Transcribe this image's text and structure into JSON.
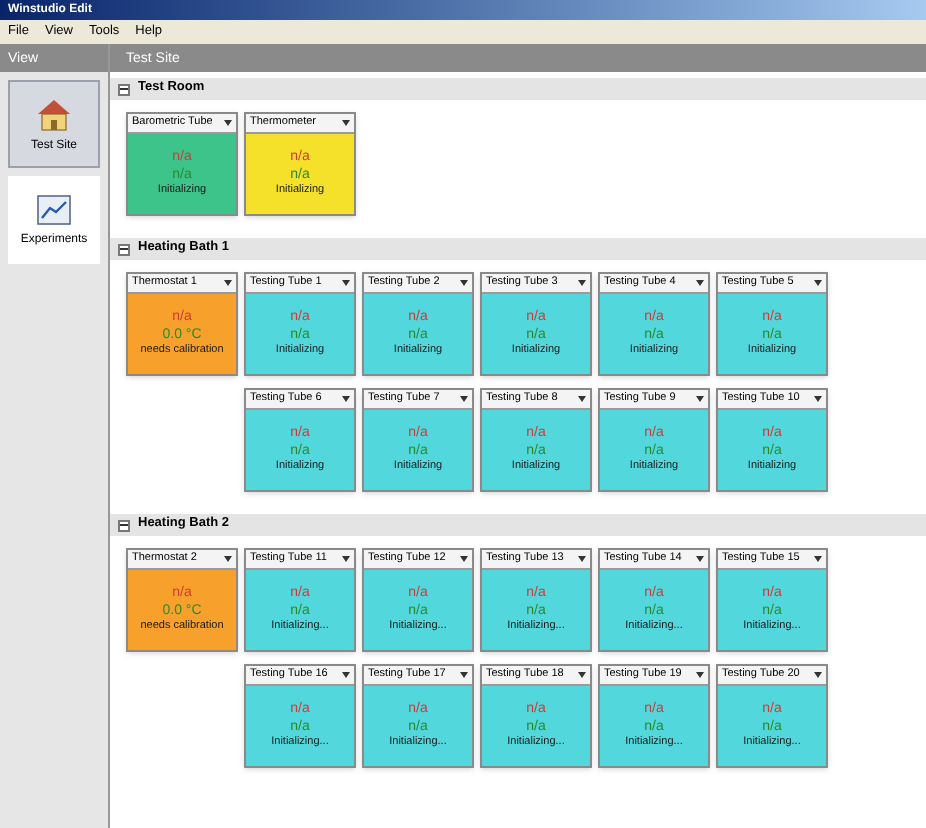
{
  "window": {
    "title": "Winstudio Edit"
  },
  "menu": [
    "File",
    "View",
    "Tools",
    "Help"
  ],
  "sidebar": {
    "title": "View",
    "items": [
      {
        "label": "Test Site",
        "selected": true
      },
      {
        "label": "Experiments",
        "selected": false
      }
    ]
  },
  "page_title": "Test Site",
  "groups": [
    {
      "title": "Test Room",
      "expanded": true,
      "rows": [
        [
          {
            "name": "Barometric Tube",
            "color": "#3cc48a",
            "reading": "n/a",
            "value": "n/a",
            "status": "Initializing"
          },
          {
            "name": "Thermometer",
            "color": "#f5e02a",
            "reading": "n/a",
            "value": "n/a",
            "status": "Initializing"
          }
        ]
      ]
    },
    {
      "title": "Heating Bath 1",
      "expanded": true,
      "rows": [
        [
          {
            "name": "Thermostat 1",
            "color": "#f7a12c",
            "reading": "n/a",
            "value": "0.0 °C",
            "status": "needs calibration"
          },
          {
            "name": "Testing Tube 1",
            "color": "#52d8dc",
            "reading": "n/a",
            "value": "n/a",
            "status": "Initializing"
          },
          {
            "name": "Testing Tube 2",
            "color": "#52d8dc",
            "reading": "n/a",
            "value": "n/a",
            "status": "Initializing"
          },
          {
            "name": "Testing Tube 3",
            "color": "#52d8dc",
            "reading": "n/a",
            "value": "n/a",
            "status": "Initializing"
          },
          {
            "name": "Testing Tube 4",
            "color": "#52d8dc",
            "reading": "n/a",
            "value": "n/a",
            "status": "Initializing"
          },
          {
            "name": "Testing Tube 5",
            "color": "#52d8dc",
            "reading": "n/a",
            "value": "n/a",
            "status": "Initializing"
          }
        ],
        [
          "",
          {
            "name": "Testing Tube 6",
            "color": "#52d8dc",
            "reading": "n/a",
            "value": "n/a",
            "status": "Initializing"
          },
          {
            "name": "Testing Tube 7",
            "color": "#52d8dc",
            "reading": "n/a",
            "value": "n/a",
            "status": "Initializing"
          },
          {
            "name": "Testing Tube 8",
            "color": "#52d8dc",
            "reading": "n/a",
            "value": "n/a",
            "status": "Initializing"
          },
          {
            "name": "Testing Tube 9",
            "color": "#52d8dc",
            "reading": "n/a",
            "value": "n/a",
            "status": "Initializing"
          },
          {
            "name": "Testing Tube 10",
            "color": "#52d8dc",
            "reading": "n/a",
            "value": "n/a",
            "status": "Initializing"
          }
        ]
      ]
    },
    {
      "title": "Heating Bath 2",
      "expanded": true,
      "rows": [
        [
          {
            "name": "Thermostat 2",
            "color": "#f7a12c",
            "reading": "n/a",
            "value": "0.0 °C",
            "status": "needs calibration"
          },
          {
            "name": "Testing Tube 11",
            "color": "#52d8dc",
            "reading": "n/a",
            "value": "n/a",
            "status": "Initializing..."
          },
          {
            "name": "Testing Tube 12",
            "color": "#52d8dc",
            "reading": "n/a",
            "value": "n/a",
            "status": "Initializing..."
          },
          {
            "name": "Testing Tube 13",
            "color": "#52d8dc",
            "reading": "n/a",
            "value": "n/a",
            "status": "Initializing..."
          },
          {
            "name": "Testing Tube 14",
            "color": "#52d8dc",
            "reading": "n/a",
            "value": "n/a",
            "status": "Initializing..."
          },
          {
            "name": "Testing Tube 15",
            "color": "#52d8dc",
            "reading": "n/a",
            "value": "n/a",
            "status": "Initializing..."
          }
        ],
        [
          "",
          {
            "name": "Testing Tube 16",
            "color": "#52d8dc",
            "reading": "n/a",
            "value": "n/a",
            "status": "Initializing..."
          },
          {
            "name": "Testing Tube 17",
            "color": "#52d8dc",
            "reading": "n/a",
            "value": "n/a",
            "status": "Initializing..."
          },
          {
            "name": "Testing Tube 18",
            "color": "#52d8dc",
            "reading": "n/a",
            "value": "n/a",
            "status": "Initializing..."
          },
          {
            "name": "Testing Tube 19",
            "color": "#52d8dc",
            "reading": "n/a",
            "value": "n/a",
            "status": "Initializing..."
          },
          {
            "name": "Testing Tube 20",
            "color": "#52d8dc",
            "reading": "n/a",
            "value": "n/a",
            "status": "Initializing..."
          }
        ]
      ]
    }
  ]
}
